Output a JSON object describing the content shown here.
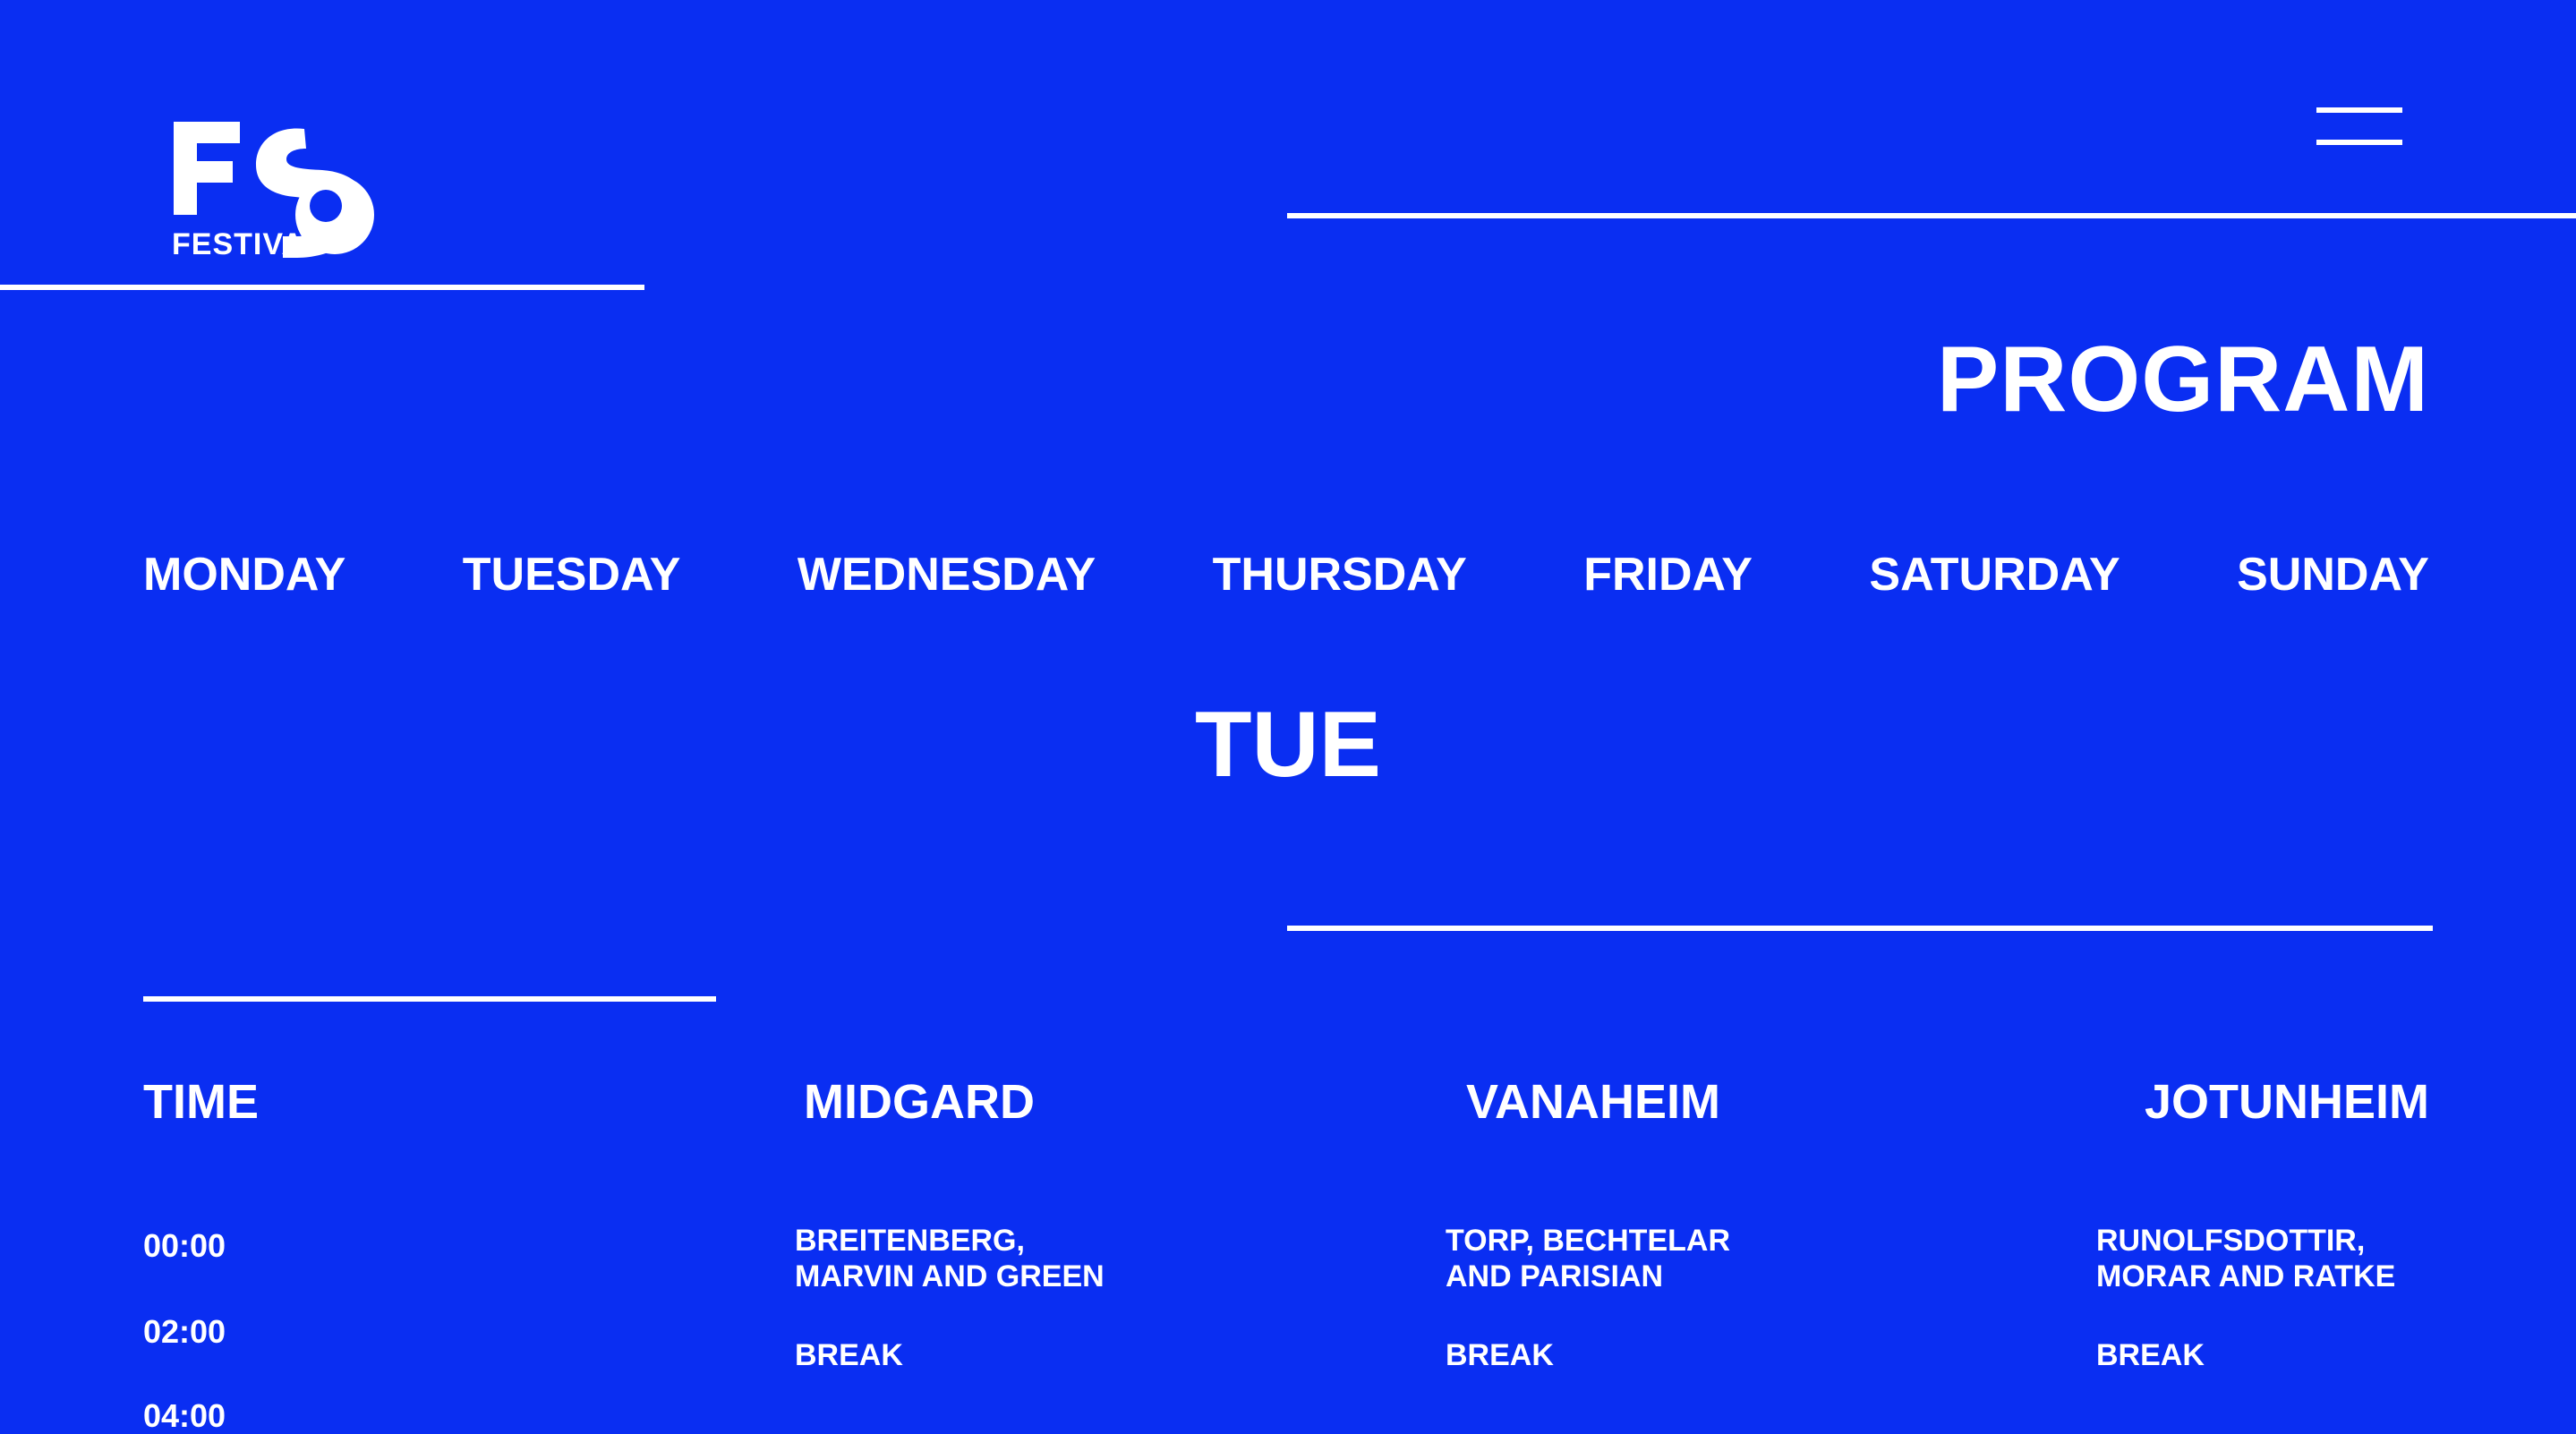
{
  "colors": {
    "background": "#0a2ef2",
    "foreground": "#ffffff"
  },
  "logo": {
    "letters": "FS",
    "caption": "FESTIVAL",
    "icon": "festival-logo"
  },
  "menu": {
    "icon": "hamburger-menu-icon"
  },
  "page_title": "PROGRAM",
  "days": [
    "MONDAY",
    "TUESDAY",
    "WEDNESDAY",
    "THURSDAY",
    "FRIDAY",
    "SATURDAY",
    "SUNDAY"
  ],
  "current_day": "TUE",
  "schedule": {
    "headers": {
      "time": "TIME",
      "stage1": "MIDGARD",
      "stage2": "VANAHEIM",
      "stage3": "JOTUNHEIM"
    },
    "times": [
      "00:00",
      "02:00",
      "04:00"
    ],
    "stage1": [
      {
        "line1": "BREITENBERG,",
        "line2": "MARVIN AND GREEN"
      },
      {
        "line1": "BREAK",
        "line2": ""
      }
    ],
    "stage2": [
      {
        "line1": "TORP, BECHTELAR",
        "line2": "AND PARISIAN"
      },
      {
        "line1": "BREAK",
        "line2": ""
      }
    ],
    "stage3": [
      {
        "line1": "RUNOLFSDOTTIR,",
        "line2": "MORAR AND RATKE"
      },
      {
        "line1": "BREAK",
        "line2": ""
      }
    ]
  }
}
